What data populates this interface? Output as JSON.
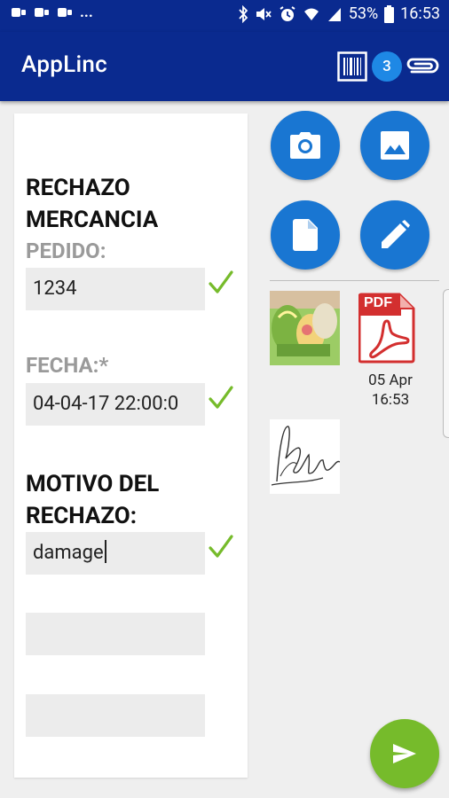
{
  "status_bar": {
    "battery": "53%",
    "time": "16:53",
    "dots": "..."
  },
  "app_bar": {
    "title": "AppLinc",
    "attachment_count": "3"
  },
  "form": {
    "section_title": "RECHAZO MERCANCIA",
    "pedido_label": "PEDIDO:",
    "pedido_value": "1234",
    "fecha_label": "FECHA:*",
    "fecha_value": "04-04-17 22:00:0",
    "motivo_label": "MOTIVO DEL RECHAZO:",
    "motivo_value": "damage",
    "extra_field_1": "",
    "extra_field_2": ""
  },
  "attachments": {
    "pdf_badge": "PDF",
    "pdf_caption": "05 Apr 16:53"
  },
  "colors": {
    "app_bar": "#0a2a8f",
    "accent_blue": "#1976d2",
    "check_green": "#76bb2b",
    "send_green": "#76bb2b",
    "pdf_red": "#d32f2f"
  }
}
